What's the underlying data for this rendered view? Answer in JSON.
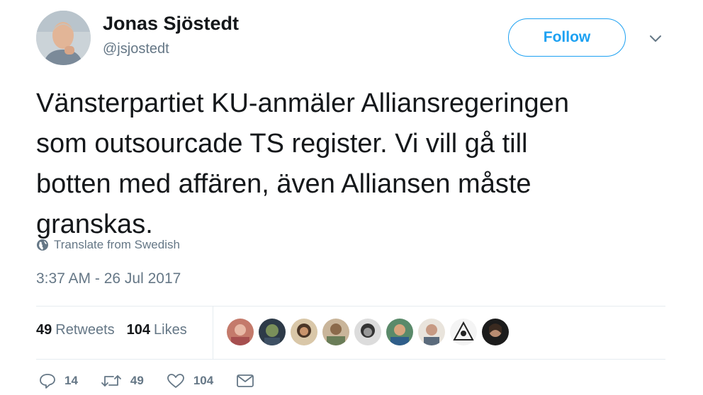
{
  "tweet": {
    "author": {
      "name": "Jonas Sjöstedt",
      "handle": "@jsjostedt",
      "avatar_icon": "profile-photo-avatar"
    },
    "follow_label": "Follow",
    "menu_icon": "chevron-down-icon",
    "text_lines": [
      "Vänsterpartiet KU-anmäler Alliansregeringen",
      "som outsourcade TS register. Vi vill gå till",
      "botten med affären, även Alliansen måste",
      "granskas."
    ],
    "translate_label": "Translate from Swedish",
    "timestamp": "3:37 AM - 26 Jul 2017",
    "stats": {
      "retweets_count": "49",
      "retweets_label": "Retweets",
      "likes_count": "104",
      "likes_label": "Likes"
    },
    "liker_avatars": [
      "liker-1",
      "liker-2",
      "liker-3",
      "liker-4",
      "liker-5",
      "liker-6",
      "liker-7",
      "liker-8",
      "liker-9"
    ],
    "actions": {
      "reply_count": "14",
      "retweet_count": "49",
      "like_count": "104"
    }
  },
  "colors": {
    "accent": "#1da1f2",
    "text": "#14171a",
    "muted": "#657786",
    "divider": "#e6ecf0"
  }
}
